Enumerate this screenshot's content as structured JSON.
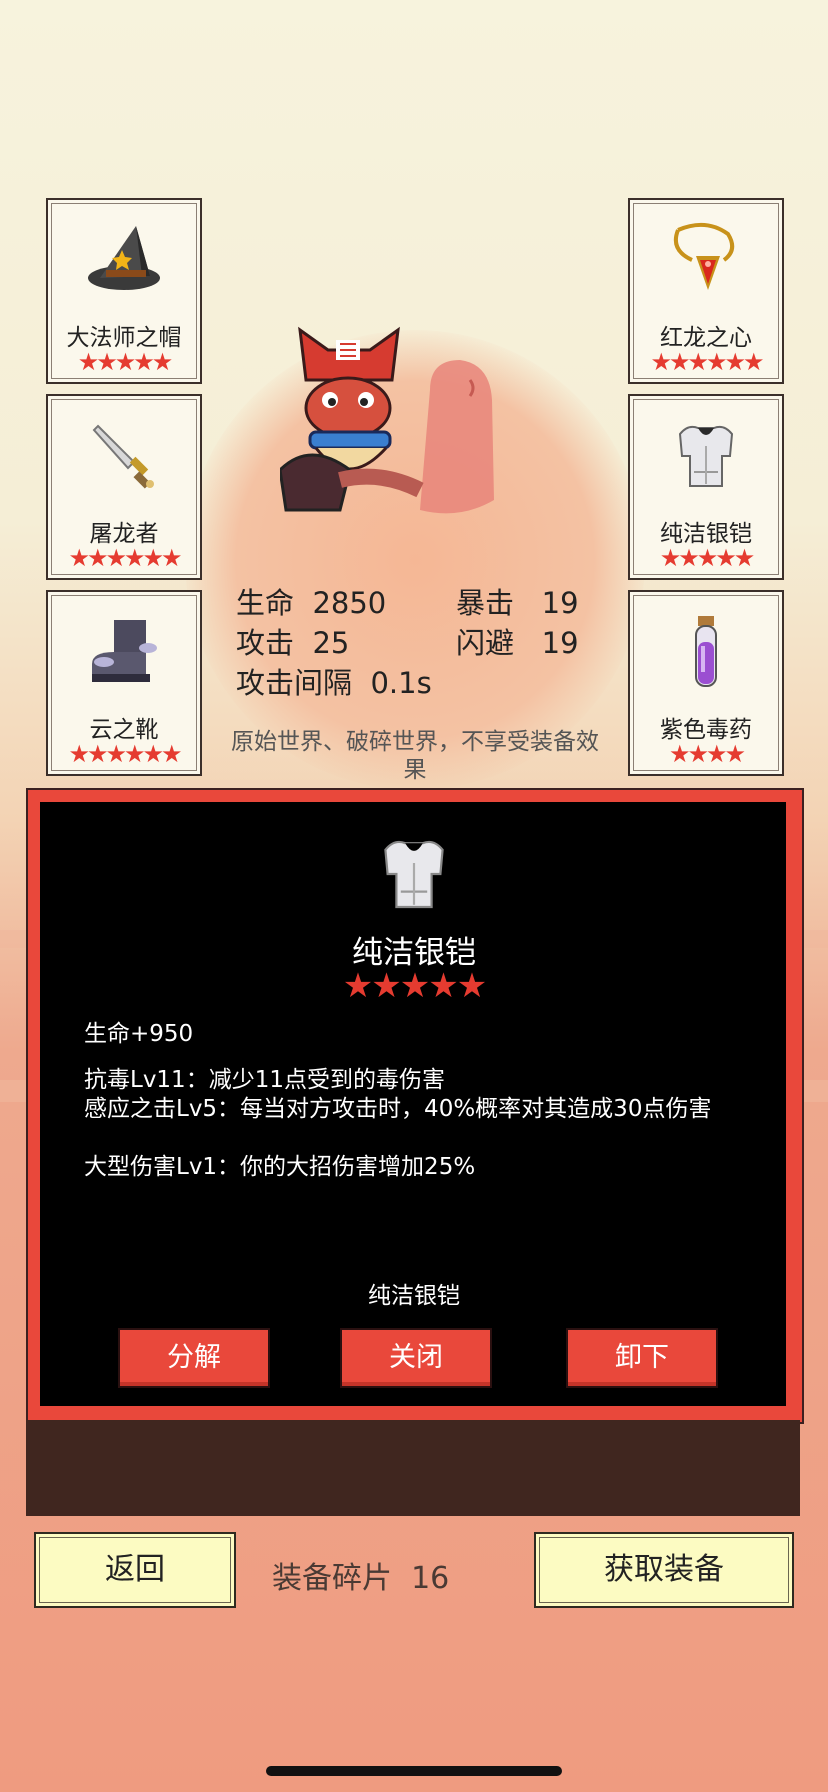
{
  "equipment_left": [
    {
      "name": "大法师之帽",
      "stars": "★★★★★",
      "icon": "wizard-hat-icon"
    },
    {
      "name": "屠龙者",
      "stars": "★★★★★★",
      "icon": "dagger-icon"
    },
    {
      "name": "云之靴",
      "stars": "★★★★★★",
      "icon": "boots-icon"
    }
  ],
  "equipment_right": [
    {
      "name": "红龙之心",
      "stars": "★★★★★★",
      "icon": "red-amulet-icon"
    },
    {
      "name": "纯洁银铠",
      "stars": "★★★★★",
      "icon": "silver-armor-icon"
    },
    {
      "name": "紫色毒药",
      "stars": "★★★★",
      "icon": "purple-potion-icon"
    }
  ],
  "stats": {
    "hp_label": "生命",
    "hp_value": "2850",
    "crit_label": "暴击",
    "crit_value": "19",
    "atk_label": "攻击",
    "atk_value": "25",
    "dodge_label": "闪避",
    "dodge_value": "19",
    "interval_label": "攻击间隔",
    "interval_value": "0.1s"
  },
  "note": "原始世界、破碎世界，不享受装备效果",
  "detail": {
    "name": "纯洁银铠",
    "stars": "★★★★★",
    "bonus": "生命+950",
    "effects": [
      "抗毒Lv11：减少11点受到的毒伤害",
      "感应之击Lv5：每当对方攻击时，40%概率对其造成30点伤害",
      "大型伤害Lv1：你的大招伤害增加25%"
    ],
    "footer_name": "纯洁银铠",
    "buttons": {
      "decompose": "分解",
      "close": "关闭",
      "unequip": "卸下"
    }
  },
  "bottom": {
    "back": "返回",
    "fragments_label": "装备碎片",
    "fragments_value": "16",
    "get_equipment": "获取装备"
  },
  "colors": {
    "accent_red": "#e9483b",
    "star_red": "#e53b30",
    "button_yellow": "#fcfbc2",
    "panel_bg": "#000000"
  }
}
